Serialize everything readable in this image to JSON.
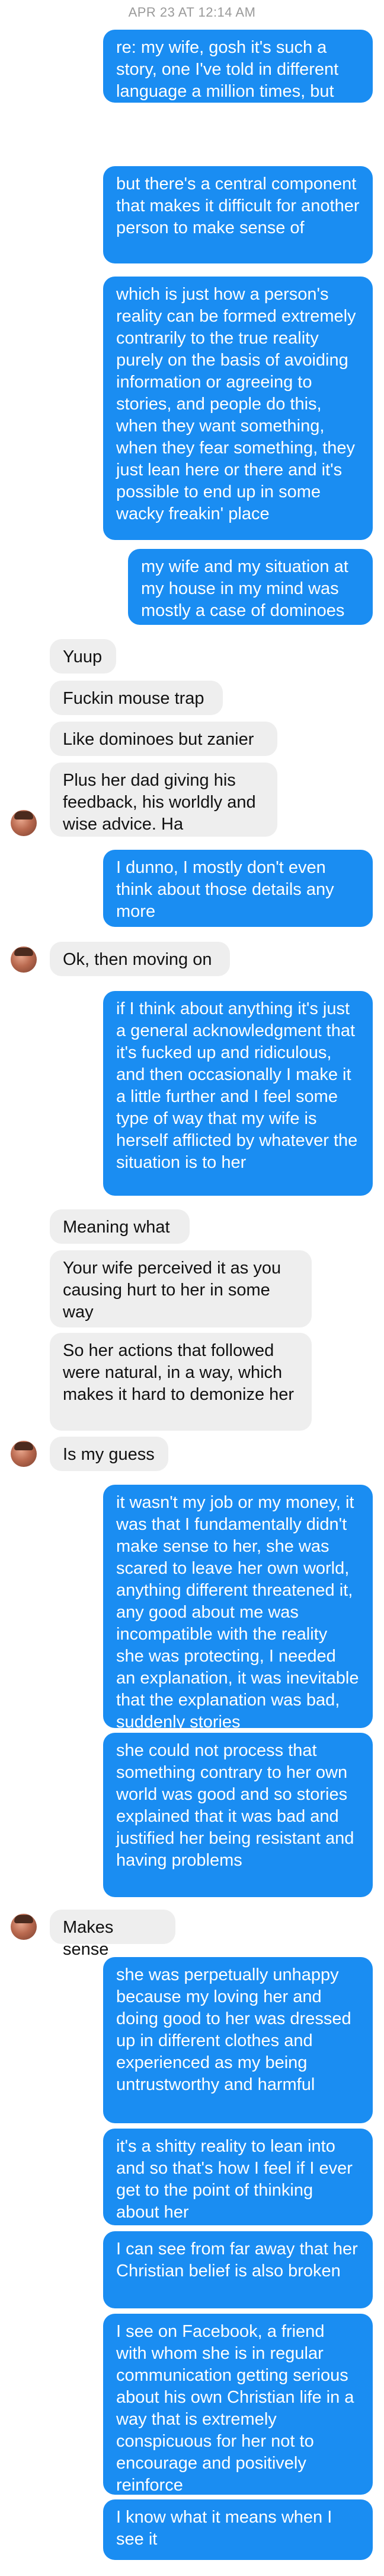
{
  "timestamp": "APR 23 AT 12:14 AM",
  "contact_avatar_icon": "user-avatar-icon",
  "colors": {
    "outgoing": "#1a8df2",
    "incoming": "#eeeeee",
    "timestamp": "#9a9a9a"
  },
  "messages": [
    {
      "dir": "out",
      "text": "re: my wife, gosh it's such a story, one I've told in different language a million times, but one that hasn't particularly changed from day one"
    },
    {
      "dir": "out",
      "text": "but there's a central component that makes it difficult for another person to make sense of"
    },
    {
      "dir": "out",
      "text": "which is just how a person's reality can be formed extremely contrarily to the true reality purely on the basis of avoiding information or agreeing to stories, and people do this, when they want something, when they fear something, they just lean here or there and it's possible to end up in some wacky freakin' place"
    },
    {
      "dir": "out",
      "text": "my wife and my situation at my house in my mind was mostly a case of dominoes"
    },
    {
      "dir": "in",
      "text": "Yuup"
    },
    {
      "dir": "in",
      "text": "Fuckin mouse trap"
    },
    {
      "dir": "in",
      "text": "Like dominoes but zanier"
    },
    {
      "dir": "in",
      "text": "Plus her dad giving his feedback, his worldly and wise advice. Ha"
    },
    {
      "dir": "out",
      "text": "I dunno, I mostly don't even think about those details any more"
    },
    {
      "dir": "in",
      "text": "Ok, then moving on"
    },
    {
      "dir": "out",
      "text": "if I think about anything it's just a general acknowledgment that it's fucked up and ridiculous, and then occasionally I make it a little further and I feel some type of way that my wife is herself afflicted by whatever the situation is to her"
    },
    {
      "dir": "in",
      "text": "Meaning what"
    },
    {
      "dir": "in",
      "text": "Your wife perceived it as you causing hurt to her in some way"
    },
    {
      "dir": "in",
      "text": "So her actions that followed were natural, in a way, which makes it hard to demonize her"
    },
    {
      "dir": "in",
      "text": "Is my guess"
    },
    {
      "dir": "out",
      "text": "it wasn't my job or my money, it was that I fundamentally didn't make sense to her, she was scared to leave her own world, anything different threatened it, any good about me was incompatible with the reality she was protecting, I needed an explanation, it was inevitable that the explanation was bad, suddenly stories"
    },
    {
      "dir": "out",
      "text": "she could not process that something contrary to her own world was good and so stories explained that it was bad and justified her being resistant and having problems"
    },
    {
      "dir": "in",
      "text": "Makes sense"
    },
    {
      "dir": "out",
      "text": "she was perpetually unhappy because my loving her and doing good to her was dressed up in different clothes and experienced as my being untrustworthy and harmful"
    },
    {
      "dir": "out",
      "text": "it's a shitty reality to lean into and so that's how I feel if I ever get to the point of thinking about her"
    },
    {
      "dir": "out",
      "text": "I can see from far away that her Christian belief is also broken"
    },
    {
      "dir": "out",
      "text": "I see on Facebook, a friend with whom she is in regular communication getting serious about his own Christian life in a way that is extremely conspicuous for her not to encourage and positively reinforce"
    },
    {
      "dir": "out",
      "text": "I know what it means when I see it"
    }
  ]
}
